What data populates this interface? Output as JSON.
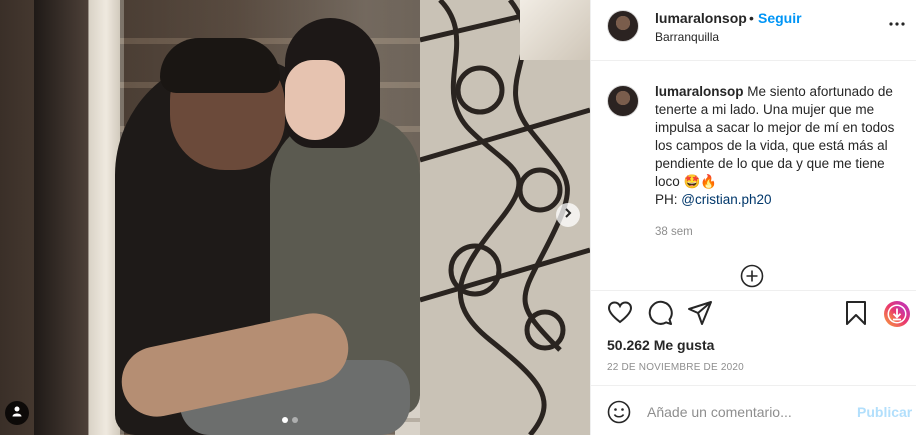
{
  "post": {
    "username": "lumaralonsop",
    "separator": "•",
    "follow_label": "Seguir",
    "location": "Barranquilla",
    "caption_text": "Me siento afortunado de tenerte a mi lado. Una mujer que me impulsa a sacar lo mejor de mí en todos los campos de la vida, que está más al pendiente de lo que da y que me tiene loco 🤩🔥",
    "caption_ph_prefix": "PH: ",
    "caption_mention": "@cristian.ph20",
    "time_ago": "38 sem",
    "likes": "50.262 Me gusta",
    "date": "22 DE NOVIEMBRE DE 2020"
  },
  "comment_box": {
    "placeholder": "Añade un comentario...",
    "post_label": "Publicar"
  },
  "carousel": {
    "count": 2,
    "active_index": 0
  },
  "icons": [
    "more-options-icon",
    "chevron-right-icon",
    "user-tag-icon",
    "add-circle-icon",
    "heart-icon",
    "comment-icon",
    "share-icon",
    "bookmark-icon",
    "download-icon",
    "emoji-icon"
  ],
  "colors": {
    "link_blue": "#0095f6",
    "mention_blue": "#00376b",
    "muted_gray": "#8e8e8e",
    "text_dark": "#262626",
    "disabled_blue": "#b2dffc"
  }
}
